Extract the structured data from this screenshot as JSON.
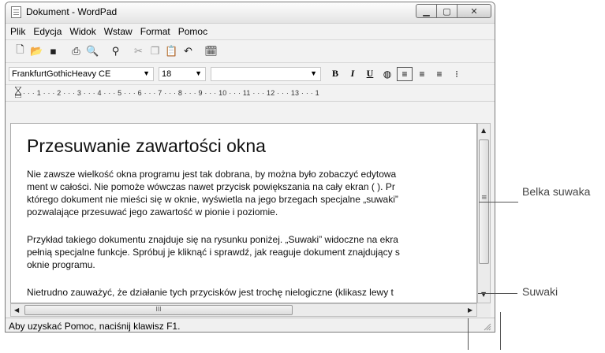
{
  "window": {
    "title": "Dokument - WordPad"
  },
  "menu": [
    "Plik",
    "Edycja",
    "Widok",
    "Wstaw",
    "Format",
    "Pomoc"
  ],
  "format_bar": {
    "font": "FrankfurtGothicHeavy CE",
    "size": "18",
    "script": ""
  },
  "ruler": {
    "ticks": "· · · 1 · · · 2 · · · 3 · · · 4 · · · 5 · · · 6 · · · 7 · · · 8 · · · 9 · · · 10 · · · 11 · · · 12 · · · 13 · · · 1"
  },
  "document": {
    "heading": "Przesuwanie zawartości okna",
    "lines": [
      "Nie zawsze wielkość okna programu jest tak dobrana, by można było zobaczyć edytowa",
      "ment w całości. Nie pomoże wówczas nawet przycisk powiększania na cały ekran ( ). Pr",
      "którego dokument nie mieści się w oknie, wyświetla na jego brzegach specjalne „suwaki”",
      "pozwalające przesuwać jego zawartość w pionie i poziomie.",
      "",
      "Przykład takiego dokumentu znajduje się na rysunku poniżej. „Suwaki” widoczne na ekra",
      "pełnią specjalne funkcje. Spróbuj je kliknąć i sprawdź, jak reaguje dokument znajdujący s",
      "oknie programu.",
      "",
      "Nietrudno zauważyć, że działanie tych przycisków jest trochę nielogiczne (klikasz lewy t"
    ]
  },
  "statusbar": {
    "text": "Aby uzyskać Pomoc, naciśnij klawisz F1."
  },
  "callouts": {
    "slider_thumb": "Belka suwaka",
    "sliders": "Suwaki"
  },
  "hscroll": {
    "thumb_glyph": "III"
  }
}
